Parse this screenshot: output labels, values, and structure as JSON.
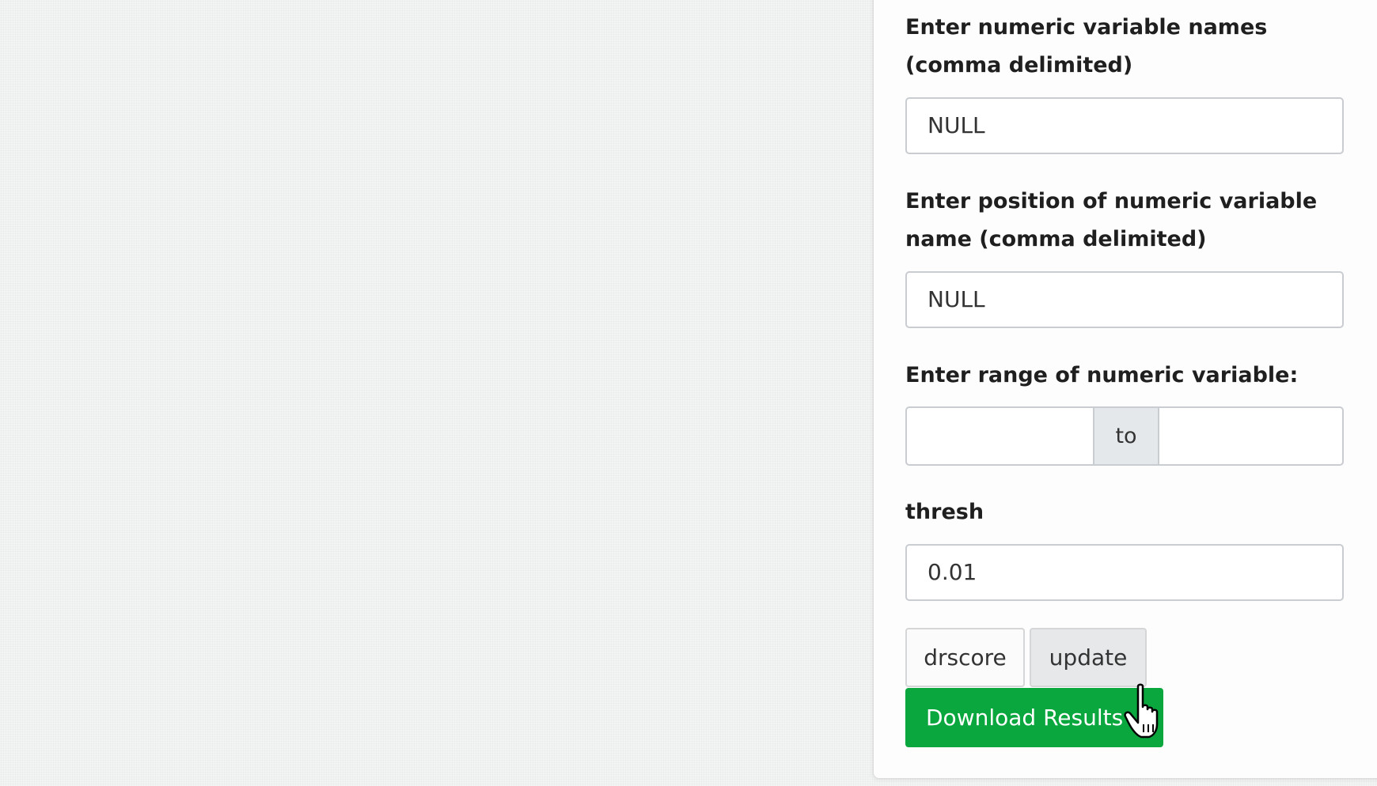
{
  "sidebar": {
    "numeric_names": {
      "label": "Enter numeric variable names (comma delimited)",
      "value": "NULL"
    },
    "numeric_positions": {
      "label": "Enter position of numeric variable name (comma delimited)",
      "value": "NULL"
    },
    "range": {
      "label": "Enter range of numeric variable:",
      "from_value": "",
      "separator": "to",
      "to_value": ""
    },
    "thresh": {
      "label": "thresh",
      "value": "0.01"
    },
    "buttons": {
      "drscore": "drscore",
      "update": "update",
      "download": "Download Results"
    }
  },
  "colors": {
    "download_button": "#0aa63e",
    "update_button_hover": "#e6e8ea",
    "field_border": "#c9ccd0"
  },
  "cursor": {
    "icon": "hand-pointer-icon"
  }
}
